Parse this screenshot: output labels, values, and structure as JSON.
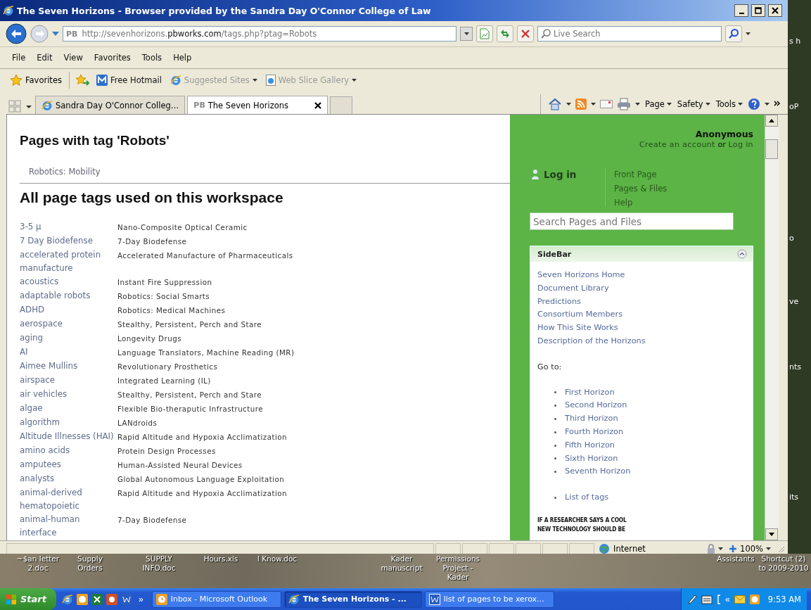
{
  "window": {
    "title": "The Seven Horizons - Browser provided by the Sandra Day O'Connor College of Law"
  },
  "address_bar": {
    "site_badge": "PB",
    "url": "http://sevenhorizons.**pbworks.com**/tags.php?ptag=Robots"
  },
  "search_box": {
    "placeholder": "Live Search"
  },
  "menu": [
    "File",
    "Edit",
    "View",
    "Favorites",
    "Tools",
    "Help"
  ],
  "favorites_button": "Favorites",
  "favorites_links": [
    {
      "label": "Free Hotmail",
      "kind": "hotmail",
      "dropdown": false,
      "disabled": false
    },
    {
      "label": "Suggested Sites",
      "kind": "ie",
      "dropdown": true,
      "disabled": true
    },
    {
      "label": "Web Slice Gallery",
      "kind": "slice",
      "dropdown": true,
      "disabled": true
    }
  ],
  "tabs": [
    {
      "label": "Sandra Day O'Connor Colleg…",
      "kind": "ie",
      "selected": false
    },
    {
      "label": "The Seven Horizons",
      "kind": "pb",
      "badge": "PB",
      "selected": true
    }
  ],
  "command_bar": [
    "Page",
    "Safety",
    "Tools"
  ],
  "page": {
    "heading": "Pages with tag 'Robots'",
    "tagged_pages": [
      "Robotics: Mobility"
    ],
    "tags_heading": "All page tags used on this workspace",
    "tags": [
      {
        "tag": "3-5 µ",
        "page": "Nano-Composite Optical Ceramic"
      },
      {
        "tag": "7 Day Biodefense",
        "page": "7-Day Biodefense"
      },
      {
        "tag": "accelerated protein manufacture",
        "page": "Accelerated Manufacture of Pharmaceuticals"
      },
      {
        "tag": "acoustics",
        "page": "Instant Fire Suppression"
      },
      {
        "tag": "adaptable robots",
        "page": "Robotics: Social Smarts"
      },
      {
        "tag": "ADHD",
        "page": "Robotics: Medical Machines"
      },
      {
        "tag": "aerospace",
        "page": "Stealthy, Persistent, Perch and Stare"
      },
      {
        "tag": "aging",
        "page": "Longevity Drugs"
      },
      {
        "tag": "AI",
        "page": "Language Translators, Machine Reading (MR)"
      },
      {
        "tag": "Aimee Mullins",
        "page": "Revolutionary Prosthetics"
      },
      {
        "tag": "airspace",
        "page": "Integrated Learning (IL)"
      },
      {
        "tag": "air vehicles",
        "page": "Stealthy, Persistent, Perch and Stare"
      },
      {
        "tag": "algae",
        "page": "Flexible Bio-theraputic Infrastructure"
      },
      {
        "tag": "algorithm",
        "page": "LANdroids"
      },
      {
        "tag": "Altitude Illnesses (HAI)",
        "page": "Rapid Altitude and Hypoxia Acclimatization"
      },
      {
        "tag": "amino acids",
        "page": "Protein Design Processes"
      },
      {
        "tag": "amputees",
        "page": "Human-Assisted Neural Devices"
      },
      {
        "tag": "analysts",
        "page": "Global Autonomous Language Exploitation"
      },
      {
        "tag": "animal-derived hematopoietic",
        "page": "Rapid Altitude and Hypoxia Acclimatization"
      },
      {
        "tag": "animal-human interface",
        "page": "7-Day Biodefense"
      }
    ]
  },
  "sidebar": {
    "user": "Anonymous",
    "account_link": "Create an account",
    "account_or": "or",
    "login_link": "Log in",
    "login_button": "Log in",
    "nav": [
      "Front Page",
      "Pages & Files",
      "Help"
    ],
    "search": {
      "placeholder": "Search Pages and Files"
    },
    "panel": {
      "title": "SideBar",
      "expanded": true,
      "links": [
        "Seven Horizons Home",
        "Document Library",
        "Predictions",
        "Consortium Members",
        "How This Site Works",
        "Description of the Horizons"
      ],
      "goto_label": "Go to:",
      "horizons": [
        "First Horizon",
        "Second Horizon",
        "Third Horizon",
        "Fourth Horizon",
        "Fifth Horizon",
        "Sixth Horizon",
        "Seventh Horizon"
      ],
      "extra_links": [
        "List of tags"
      ],
      "comic_lines": [
        "IF A RESEARCHER SAYS A COOL",
        "NEW TECHNOLOGY SHOULD BE"
      ]
    }
  },
  "status_bar": {
    "zone": "Internet",
    "zoom": "100%"
  },
  "desktop_edge_labels": [
    "s h",
    "oP",
    "o",
    "ve",
    "nts",
    "its"
  ],
  "desktop_icons": [
    "~$an letter 2.doc",
    "Supply Orders",
    "SUPPLY INFO.doc",
    "Hours.xls",
    "I Know.doc",
    "Kader manuscript",
    "Permissions Project - Kader",
    "Assistants",
    "Shortcut (2) to 2009-2010"
  ],
  "taskbar": {
    "start": "Start",
    "quick_launch_more": "»",
    "tasks": [
      {
        "label": "Inbox - Microsoft Outlook",
        "kind": "outlook",
        "selected": false
      },
      {
        "label": "The Seven Horizons - ...",
        "kind": "ie",
        "selected": true
      },
      {
        "label": "list of pages to be xerox...",
        "kind": "word",
        "selected": false
      }
    ],
    "tray_more": "«",
    "time": "9:53 AM"
  }
}
